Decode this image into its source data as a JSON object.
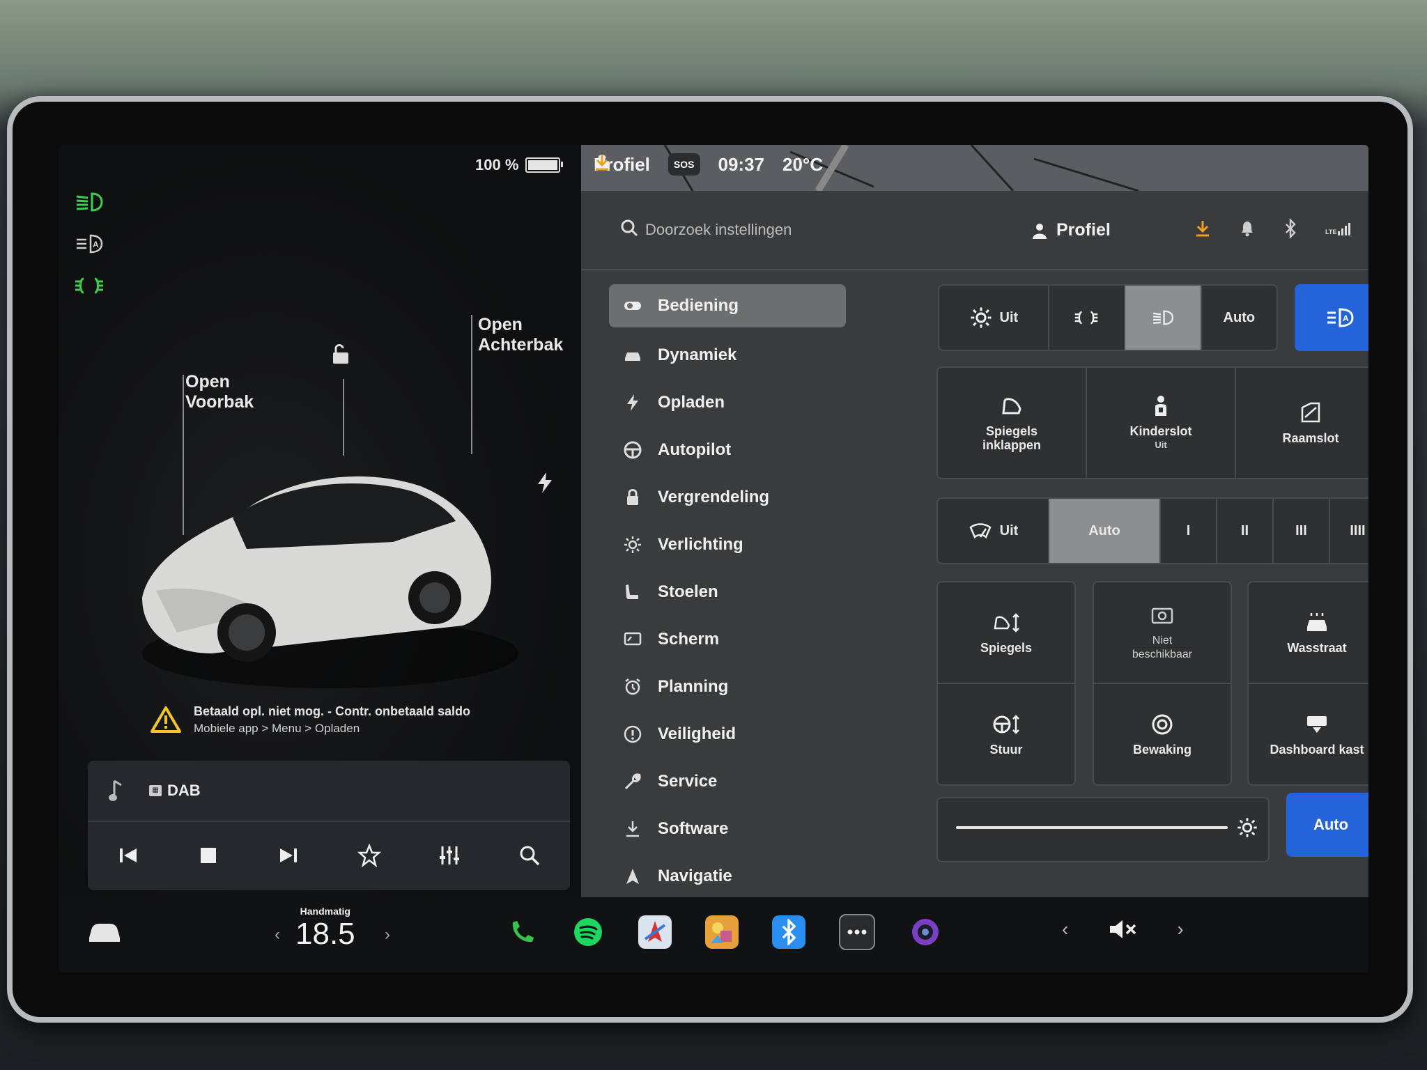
{
  "left": {
    "battery_percent": "100 %",
    "battery_level": 1.0,
    "label_open_frunk": "Open\nVoorbak",
    "label_open_trunk": "Open\nAchterbak",
    "alert_title": "Betaald opl. niet mog. - Contr. onbetaald saldo",
    "alert_sub": "Mobiele app > Menu > Opladen",
    "media_source": "DAB"
  },
  "top_status": {
    "profile": "Profiel",
    "sos": "SOS",
    "time": "09:37",
    "temperature": "20°C"
  },
  "header": {
    "search_placeholder": "Doorzoek instellingen",
    "profile": "Profiel",
    "signal": "LTE"
  },
  "menu": [
    {
      "label": "Bediening",
      "icon": "toggle-icon"
    },
    {
      "label": "Dynamiek",
      "icon": "car-icon"
    },
    {
      "label": "Opladen",
      "icon": "bolt-icon"
    },
    {
      "label": "Autopilot",
      "icon": "steering-wheel-icon"
    },
    {
      "label": "Vergrendeling",
      "icon": "lock-icon"
    },
    {
      "label": "Verlichting",
      "icon": "sun-icon"
    },
    {
      "label": "Stoelen",
      "icon": "seat-icon"
    },
    {
      "label": "Scherm",
      "icon": "display-icon"
    },
    {
      "label": "Planning",
      "icon": "alarm-icon"
    },
    {
      "label": "Veiligheid",
      "icon": "info-circle-icon"
    },
    {
      "label": "Service",
      "icon": "wrench-icon"
    },
    {
      "label": "Software",
      "icon": "download-icon"
    },
    {
      "label": "Navigatie",
      "icon": "nav-arrow-icon"
    }
  ],
  "lights": {
    "off": "Uit",
    "auto": "Auto"
  },
  "row2": {
    "mirrors_fold": "Spiegels\ninklappen",
    "child_lock": "Kinderslot",
    "child_lock_sub": "Uit",
    "window_lock": "Raamslot"
  },
  "wipers": {
    "off": "Uit",
    "auto": "Auto",
    "levels": [
      "I",
      "II",
      "III",
      "IIII"
    ]
  },
  "row4": {
    "mirrors": "Spiegels",
    "unavailable": "Niet\nbeschikbaar",
    "car_wash": "Wasstraat",
    "steering": "Stuur",
    "sentry": "Bewaking",
    "glovebox": "Dashboard kast"
  },
  "brightness": {
    "auto": "Auto"
  },
  "dock": {
    "temp_label": "Handmatig",
    "temp_value": "18.5"
  },
  "colors": {
    "accent_blue": "#2463d9",
    "lamp_green": "#3bd14a",
    "download_orange": "#f0a020"
  }
}
